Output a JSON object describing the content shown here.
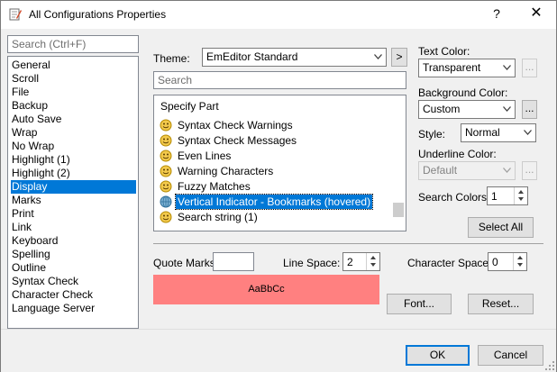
{
  "window": {
    "title": "All Configurations Properties",
    "help_label": "?",
    "close_label": "✕"
  },
  "search": {
    "category_placeholder": "Search (Ctrl+F)",
    "part_placeholder": "Search"
  },
  "categories": [
    "General",
    "Scroll",
    "File",
    "Backup",
    "Auto Save",
    "Wrap",
    "No Wrap",
    "Highlight (1)",
    "Highlight (2)",
    "Display",
    "Marks",
    "Print",
    "Link",
    "Keyboard",
    "Spelling",
    "Outline",
    "Syntax Check",
    "Character Check",
    "Language Server"
  ],
  "selected_category": "Display",
  "theme": {
    "label": "Theme:",
    "value": "EmEditor Standard",
    "next_label": ">"
  },
  "parts": {
    "header": "Specify Part",
    "items": [
      "Syntax Check Warnings",
      "Syntax Check Messages",
      "Even Lines",
      "Warning Characters",
      "Fuzzy Matches",
      "Vertical Indicator - Bookmarks (hovered)",
      "Search string (1)"
    ],
    "selected": "Vertical Indicator - Bookmarks (hovered)"
  },
  "right_panel": {
    "text_color_label": "Text Color:",
    "text_color_value": "Transparent",
    "background_color_label": "Background Color:",
    "background_color_value": "Custom",
    "style_label": "Style:",
    "style_value": "Normal",
    "underline_color_label": "Underline Color:",
    "underline_color_value": "Default",
    "search_colors_label": "Search Colors:",
    "search_colors_value": "1",
    "ellipsis_label": "...",
    "select_all_label": "Select All"
  },
  "options": {
    "quote_marks_label": "Quote Marks",
    "quote_marks_value": "",
    "line_space_label": "Line Space:",
    "line_space_value": "2",
    "character_space_label": "Character Space:",
    "character_space_value": "0"
  },
  "preview": {
    "text": "AaBbCc",
    "background_color": "#ff8080"
  },
  "buttons": {
    "font_label": "Font...",
    "reset_label": "Reset...",
    "ok_label": "OK",
    "cancel_label": "Cancel"
  },
  "colors": {
    "accent": "#0078d7"
  }
}
